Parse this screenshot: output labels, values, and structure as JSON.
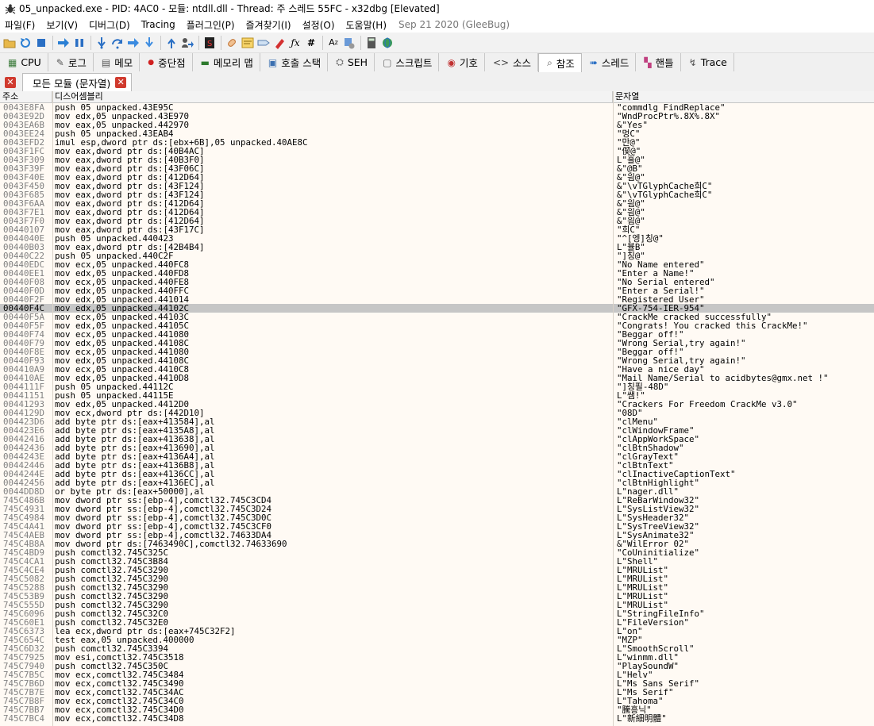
{
  "window": {
    "title": "05_unpacked.exe - PID: 4AC0 - 모듈: ntdll.dll - Thread: 주 스레드 55FC - x32dbg [Elevated]"
  },
  "menu": {
    "items": [
      "파일(F)",
      "보기(V)",
      "디버그(D)",
      "Tracing",
      "플러그인(P)",
      "즐겨찾기(I)",
      "설정(O)",
      "도움말(H)"
    ],
    "build_date": "Sep 21 2020 (GleeBug)"
  },
  "toolbar": {
    "icons": [
      "open-icon",
      "restart-icon",
      "stop-icon",
      "run-icon",
      "pause-icon",
      "step-into-icon",
      "step-over-icon",
      "trace-into-icon",
      "trace-over-icon",
      "execute-till-return-icon",
      "run-to-user-code-icon",
      "scylla-icon",
      "patch-icon",
      "comment-icon",
      "label-icon",
      "bookmark-icon",
      "function-icon",
      "argument-icon",
      "font-icon",
      "preferences-icon",
      "calculator-icon",
      "help-icon"
    ]
  },
  "tabs": [
    {
      "label": "CPU",
      "icon": "cpu-icon",
      "glyph": "▦"
    },
    {
      "label": "로그",
      "icon": "log-icon",
      "glyph": "✎"
    },
    {
      "label": "메모",
      "icon": "notes-icon",
      "glyph": "▤"
    },
    {
      "label": "중단점",
      "icon": "breakpoint-icon",
      "glyph": "●"
    },
    {
      "label": "메모리 맵",
      "icon": "memory-map-icon",
      "glyph": "▬"
    },
    {
      "label": "호출 스택",
      "icon": "call-stack-icon",
      "glyph": "▣"
    },
    {
      "label": "SEH",
      "icon": "seh-icon",
      "glyph": "⛭"
    },
    {
      "label": "스크립트",
      "icon": "script-icon",
      "glyph": "▢"
    },
    {
      "label": "기호",
      "icon": "symbols-icon",
      "glyph": "◉"
    },
    {
      "label": "소스",
      "icon": "source-icon",
      "glyph": "<>"
    },
    {
      "label": "참조",
      "icon": "references-icon",
      "glyph": "⌕"
    },
    {
      "label": "스레드",
      "icon": "threads-icon",
      "glyph": "➠"
    },
    {
      "label": "핸들",
      "icon": "handles-icon",
      "glyph": "▚"
    },
    {
      "label": "Trace",
      "icon": "trace-icon",
      "glyph": "↯"
    }
  ],
  "subtab": {
    "label": "모든 모듈 (문자열)"
  },
  "columns": {
    "address": "주소",
    "disassembly": "디스어셈블리",
    "string": "문자열"
  },
  "rows": [
    [
      "0043E8FA",
      "push 05_unpacked.43E95C",
      "\"commdlg_FindReplace\""
    ],
    [
      "0043E92D",
      "mov edx,05_unpacked.43E970",
      "\"WndProcPtr%.8X%.8X\""
    ],
    [
      "0043EA6B",
      "mov eax,05_unpacked.442970",
      "&\"Yes\""
    ],
    [
      "0043EE24",
      "push 05_unpacked.43EAB4",
      "\"멍C\""
    ],
    [
      "0043EFD2",
      "imul esp,dword ptr ds:[ebx+6B],05_unpacked.40AE8C",
      "\"만@\""
    ],
    [
      "0043F1FC",
      "mov eax,dword ptr ds:[40B4AC]",
      "\"偰@\""
    ],
    [
      "0043F309",
      "mov eax,dword ptr ds:[40B3F0]",
      "L\"흘@\""
    ],
    [
      "0043F39F",
      "mov eax,dword ptr ds:[43F06C]",
      "&\"@B\""
    ],
    [
      "0043F40E",
      "mov eax,dword ptr ds:[412D64]",
      "&\"읨@\""
    ],
    [
      "0043F450",
      "mov eax,dword ptr ds:[43F124]",
      "&\"\\vTGlyphCache희C\""
    ],
    [
      "0043F685",
      "mov eax,dword ptr ds:[43F124]",
      "&\"\\vTGlyphCache희C\""
    ],
    [
      "0043F6AA",
      "mov eax,dword ptr ds:[412D64]",
      "&\"읨@\""
    ],
    [
      "0043F7E1",
      "mov eax,dword ptr ds:[412D64]",
      "&\"읨@\""
    ],
    [
      "0043F7F0",
      "mov eax,dword ptr ds:[412D64]",
      "&\"읨@\""
    ],
    [
      "00440107",
      "mov eax,dword ptr ds:[43F17C]",
      "\"희C\""
    ],
    [
      "0044040E",
      "push 05_unpacked.440423",
      "\"^[엥]칭@\""
    ],
    [
      "00440B03",
      "mov eax,dword ptr ds:[42B4B4]",
      "L\"뷸B\""
    ],
    [
      "00440C22",
      "push 05_unpacked.440C2F",
      "\"]칭@\""
    ],
    [
      "00440EDC",
      "mov ecx,05_unpacked.440FC8",
      "\"No Name entered\""
    ],
    [
      "00440EE1",
      "mov edx,05_unpacked.440FD8",
      "\"Enter a Name!\""
    ],
    [
      "00440F08",
      "mov ecx,05_unpacked.440FE8",
      "\"No Serial entered\""
    ],
    [
      "00440F0D",
      "mov edx,05_unpacked.440FFC",
      "\"Enter a Serial!\""
    ],
    [
      "00440F2F",
      "mov edx,05_unpacked.441014",
      "\"Registered User\""
    ],
    [
      "00440F4C",
      "mov edx,05_unpacked.44102C",
      "\"GFX-754-IER-954\""
    ],
    [
      "00440F5A",
      "mov ecx,05_unpacked.44103C",
      "\"CrackMe cracked successfully\""
    ],
    [
      "00440F5F",
      "mov edx,05_unpacked.44105C",
      "\"Congrats! You cracked this CrackMe!\""
    ],
    [
      "00440F74",
      "mov ecx,05_unpacked.441080",
      "\"Beggar off!\""
    ],
    [
      "00440F79",
      "mov edx,05_unpacked.44108C",
      "\"Wrong Serial,try again!\""
    ],
    [
      "00440F8E",
      "mov ecx,05_unpacked.441080",
      "\"Beggar off!\""
    ],
    [
      "00440F93",
      "mov edx,05_unpacked.44108C",
      "\"Wrong Serial,try again!\""
    ],
    [
      "004410A9",
      "mov ecx,05_unpacked.4410C8",
      "\"Have a nice day\""
    ],
    [
      "004410AE",
      "mov edx,05_unpacked.4410D8",
      "\"Mail Name/Serial to acidbytes@gmx.net !\""
    ],
    [
      "0044111F",
      "push 05_unpacked.44112C",
      "\"]칭필-48D\""
    ],
    [
      "00441151",
      "push 05_unpacked.44115E",
      "L\"쌤!\""
    ],
    [
      "00441293",
      "mov edx,05_unpacked.4412D0",
      "\"Crackers For Freedom CrackMe v3.0\""
    ],
    [
      "0044129D",
      "mov ecx,dword ptr ds:[442D10]",
      "\"08D\""
    ],
    [
      "004423D6",
      "add byte ptr ds:[eax+413584],al",
      "\"clMenu\""
    ],
    [
      "004423E6",
      "add byte ptr ds:[eax+4135A8],al",
      "\"clWindowFrame\""
    ],
    [
      "00442416",
      "add byte ptr ds:[eax+413638],al",
      "\"clAppWorkSpace\""
    ],
    [
      "00442436",
      "add byte ptr ds:[eax+413690],al",
      "\"clBtnShadow\""
    ],
    [
      "0044243E",
      "add byte ptr ds:[eax+4136A4],al",
      "\"clGrayText\""
    ],
    [
      "00442446",
      "add byte ptr ds:[eax+4136B8],al",
      "\"clBtnText\""
    ],
    [
      "0044244E",
      "add byte ptr ds:[eax+4136CC],al",
      "\"clInactiveCaptionText\""
    ],
    [
      "00442456",
      "add byte ptr ds:[eax+4136EC],al",
      "\"clBtnHighlight\""
    ],
    [
      "0044DD8D",
      "or byte ptr ds:[eax+50000],al",
      "L\"nager.dll\""
    ],
    [
      "745C486B",
      "mov dword ptr ss:[ebp-4],comctl32.745C3CD4",
      "L\"ReBarWindow32\""
    ],
    [
      "745C4931",
      "mov dword ptr ss:[ebp-4],comctl32.745C3D24",
      "L\"SysListView32\""
    ],
    [
      "745C4984",
      "mov dword ptr ss:[ebp-4],comctl32.745C3D0C",
      "L\"SysHeader32\""
    ],
    [
      "745C4A41",
      "mov dword ptr ss:[ebp-4],comctl32.745C3CF0",
      "L\"SysTreeView32\""
    ],
    [
      "745C4AEB",
      "mov dword ptr ss:[ebp-4],comctl32.74633DA4",
      "L\"SysAnimate32\""
    ],
    [
      "745C4B8A",
      "mov dword ptr ds:[7463490C],comctl32.74633690",
      "&\"WilError_02\""
    ],
    [
      "745C4BD9",
      "push comctl32.745C325C",
      "\"CoUninitialize\""
    ],
    [
      "745C4CA1",
      "push comctl32.745C3B84",
      "L\"Shell\""
    ],
    [
      "745C4CE4",
      "push comctl32.745C3290",
      "L\"MRUList\""
    ],
    [
      "745C5082",
      "push comctl32.745C3290",
      "L\"MRUList\""
    ],
    [
      "745C5288",
      "push comctl32.745C3290",
      "L\"MRUList\""
    ],
    [
      "745C53B9",
      "push comctl32.745C3290",
      "L\"MRUList\""
    ],
    [
      "745C555D",
      "push comctl32.745C3290",
      "L\"MRUList\""
    ],
    [
      "745C6096",
      "push comctl32.745C32C0",
      "L\"StringFileInfo\""
    ],
    [
      "745C60E1",
      "push comctl32.745C32E0",
      "L\"FileVersion\""
    ],
    [
      "745C6373",
      "lea ecx,dword ptr ds:[eax+745C32F2]",
      "L\"on\""
    ],
    [
      "745C654C",
      "test eax,05_unpacked.400000",
      "\"MZP\""
    ],
    [
      "745C6D32",
      "push comctl32.745C3394",
      "L\"SmoothScroll\""
    ],
    [
      "745C7925",
      "mov esi,comctl32.745C3518",
      "L\"winmm.dll\""
    ],
    [
      "745C7940",
      "push comctl32.745C350C",
      "\"PlaySoundW\""
    ],
    [
      "745C7B5C",
      "mov ecx,comctl32.745C3484",
      "L\"Helv\""
    ],
    [
      "745C7B6D",
      "mov ecx,comctl32.745C3490",
      "L\"Ms Sans Serif\""
    ],
    [
      "745C7B7E",
      "mov ecx,comctl32.745C34AC",
      "L\"Ms Serif\""
    ],
    [
      "745C7B8F",
      "mov ecx,comctl32.745C34C0",
      "L\"Tahoma\""
    ],
    [
      "745C7BB7",
      "mov ecx,comctl32.745C34D0",
      "\"騰흥닉\""
    ],
    [
      "745C7BC4",
      "mov ecx,comctl32.745C34D8",
      "L\"新細明體\""
    ]
  ],
  "selected_row": 23,
  "colors": {
    "selection": "#c6c6c6",
    "grid_background": "#fffaf4",
    "address_text": "#808080"
  }
}
